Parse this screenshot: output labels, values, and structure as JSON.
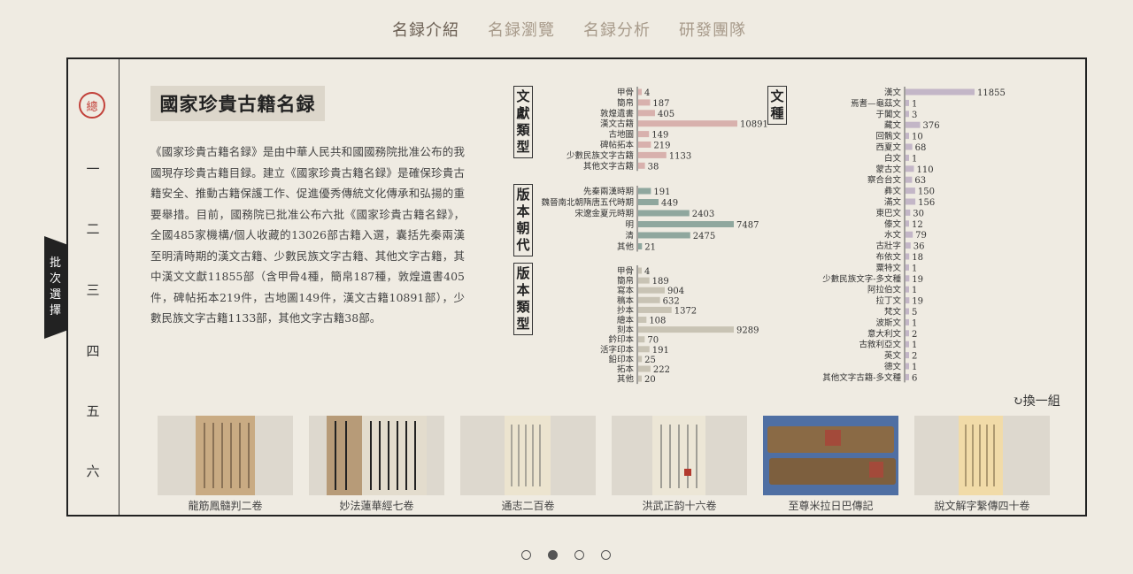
{
  "nav": [
    {
      "label": "名録介紹",
      "active": true
    },
    {
      "label": "名録瀏覽",
      "active": false
    },
    {
      "label": "名録分析",
      "active": false
    },
    {
      "label": "研發團隊",
      "active": false
    }
  ],
  "sidebar": {
    "selected": "總",
    "batches": [
      "一",
      "二",
      "三",
      "四",
      "五",
      "六"
    ],
    "tab_label": [
      "批",
      "次",
      "選",
      "擇"
    ]
  },
  "title": "國家珍貴古籍名録",
  "description": "《國家珍貴古籍名録》是由中華人民共和國國務院批准公布的我國現存珍貴古籍目録。建立《國家珍貴古籍名録》是確保珍貴古籍安全、推動古籍保護工作、促進優秀傳統文化傳承和弘揚的重要舉措。目前，國務院已批准公布六批《國家珍貴古籍名録》，全國485家機構/個人收藏的13026部古籍入選，囊括先秦兩漢至明清時期的漢文古籍、少數民族文字古籍、其他文字古籍，其中漢文文獻11855部（含甲骨4種，簡帛187種，敦煌遺書405件，碑帖拓本219件，古地圖149件，漢文古籍10891部），少數民族文字古籍1133部，其他文字古籍38部。",
  "chart_data": [
    {
      "type": "bar",
      "title": "文獻類型",
      "color": "#d8b1ad",
      "categories": [
        "甲骨",
        "簡帛",
        "敦煌遺書",
        "漢文古籍",
        "古地圖",
        "碑帖拓本",
        "少數民族文字古籍",
        "其他文字古籍"
      ],
      "values": [
        4,
        187,
        405,
        10891,
        149,
        219,
        1133,
        38
      ]
    },
    {
      "type": "bar",
      "title": "版本朝代",
      "color": "#8fa79e",
      "categories": [
        "先秦兩漢時期",
        "魏晉南北朝隋唐五代時期",
        "宋遼金夏元時期",
        "明",
        "清",
        "其他"
      ],
      "values": [
        191,
        449,
        2403,
        7487,
        2475,
        21
      ]
    },
    {
      "type": "bar",
      "title": "版本類型",
      "color": "#c8c3b4",
      "categories": [
        "甲骨",
        "簡帛",
        "寫本",
        "稿本",
        "抄本",
        "繪本",
        "刻本",
        "鈐印本",
        "活字印本",
        "鉛印本",
        "拓本",
        "其他"
      ],
      "values": [
        4,
        189,
        904,
        632,
        1372,
        108,
        9289,
        70,
        191,
        25,
        222,
        20
      ]
    },
    {
      "type": "bar",
      "title": "文種",
      "color": "#c3b6c7",
      "categories": [
        "漢文",
        "焉耆—龜茲文",
        "于闐文",
        "藏文",
        "回鶻文",
        "西夏文",
        "白文",
        "蒙古文",
        "察合台文",
        "彝文",
        "滿文",
        "東巴文",
        "傣文",
        "水文",
        "古壯字",
        "布依文",
        "粟特文",
        "少數民族文字-多文種",
        "阿拉伯文",
        "拉丁文",
        "梵文",
        "波斯文",
        "意大利文",
        "古敘利亞文",
        "英文",
        "德文",
        "其他文字古籍-多文種"
      ],
      "values": [
        11855,
        1,
        3,
        376,
        10,
        68,
        1,
        110,
        63,
        150,
        156,
        30,
        12,
        79,
        36,
        18,
        1,
        19,
        1,
        19,
        5,
        1,
        2,
        1,
        2,
        1,
        6
      ]
    }
  ],
  "swap_label": "換一組",
  "books": [
    {
      "caption": "龍筋鳳髓判二卷"
    },
    {
      "caption": "妙法蓮華經七卷"
    },
    {
      "caption": "通志二百卷"
    },
    {
      "caption": "洪武正韵十六卷"
    },
    {
      "caption": "至尊米拉日巴傳記"
    },
    {
      "caption": "說文解字繫傳四十卷"
    }
  ],
  "pagination": {
    "count": 4,
    "active": 1
  }
}
